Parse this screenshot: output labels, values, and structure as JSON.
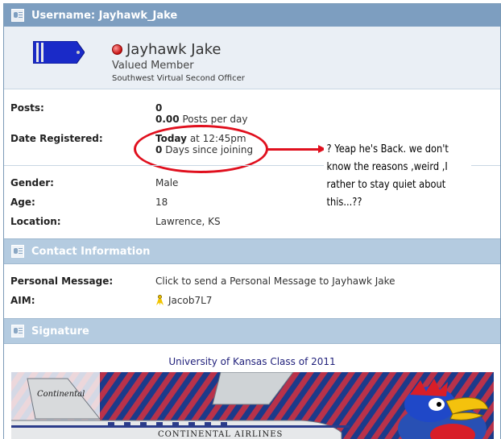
{
  "header": {
    "title": "Username: Jayhawk_Jake"
  },
  "profile": {
    "display_name": "Jayhawk Jake",
    "user_title": "Valued Member",
    "custom_title": "Southwest Virtual Second Officer"
  },
  "stats": {
    "posts_label": "Posts:",
    "posts_value": "0",
    "posts_per_day_bold": "0.00",
    "posts_per_day_text": "Posts per day",
    "registered_label": "Date Registered:",
    "registered_day": "Today",
    "registered_time": "at 12:45pm",
    "days_bold": "0",
    "days_text": "Days since joining"
  },
  "annotation": {
    "text": "? Yeap he's Back. we don't know the reasons ,weird ,I rather to stay quiet about this...??",
    "color": "#e0101e"
  },
  "info": {
    "gender_label": "Gender:",
    "gender_value": "Male",
    "age_label": "Age:",
    "age_value": "18",
    "location_label": "Location:",
    "location_value": "Lawrence, KS"
  },
  "contact": {
    "section_title": "Contact Information",
    "pm_label": "Personal Message:",
    "pm_link": "Click to send a Personal Message to Jayhawk Jake",
    "aim_label": "AIM:",
    "aim_value": "Jacob7L7",
    "aim_icon": "aim-running-man-icon"
  },
  "signature": {
    "section_title": "Signature",
    "caption": "University of Kansas Class of 2011",
    "plane_text": "CONTINENTAL AIRLINES",
    "tail_script": "Continental"
  },
  "colors": {
    "header_bg": "#7d9ec0",
    "subheader_bg": "#b4cbe0",
    "profile_bg": "#eaeff5",
    "online_dot": "#c61010"
  }
}
